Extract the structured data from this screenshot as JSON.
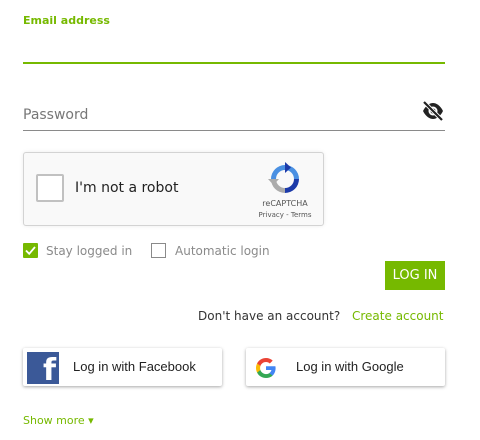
{
  "email": {
    "label": "Email address",
    "value": ""
  },
  "password": {
    "placeholder": "Password",
    "toggle_icon": "eye-off-icon"
  },
  "captcha": {
    "label": "I'm not a robot",
    "brand": "reCAPTCHA",
    "links": "Privacy - Terms",
    "checked": false
  },
  "options": {
    "stay_logged_in": {
      "label": "Stay logged in",
      "checked": true
    },
    "automatic_login": {
      "label": "Automatic login",
      "checked": false
    }
  },
  "login_button": {
    "label": "LOG IN"
  },
  "account": {
    "prompt": "Don't have an account?",
    "create_link": "Create account"
  },
  "social": {
    "facebook": {
      "label": "Log in with Facebook",
      "icon": "facebook-icon"
    },
    "google": {
      "label": "Log in with Google",
      "icon": "google-icon"
    }
  },
  "show_more": {
    "label": "Show more ▾"
  },
  "colors": {
    "accent": "#76b900",
    "facebook": "#3b5998"
  }
}
